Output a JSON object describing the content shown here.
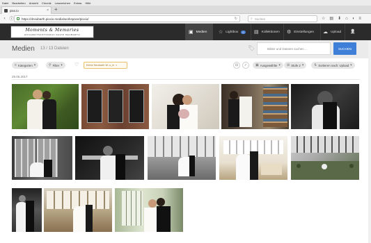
{
  "browser": {
    "menu": [
      "Datei",
      "Bearbeiten",
      "Ansicht",
      "Chronik",
      "Lesezeichen",
      "Extras",
      "Hilfe"
    ],
    "tab_title": "pixx.io",
    "url": "https://dnsubarth.pixxio.media/workspace/pixxio/",
    "search_placeholder": "Suchen",
    "new_tab": "+"
  },
  "logo": {
    "line1": "Moments & Memories",
    "line2": "HOCHZEITSFOTOGRAF DAVID NEUBARTH"
  },
  "nav": [
    {
      "label": "Medien",
      "icon": "▣",
      "active": true
    },
    {
      "label": "Lightbox",
      "icon": "☆",
      "badge": "0"
    },
    {
      "label": "Kollektionen",
      "icon": "▤"
    },
    {
      "label": "Einstellungen",
      "icon": "⚙"
    },
    {
      "label": "Upload",
      "icon": "☁"
    },
    {
      "label": "",
      "icon": "👤"
    }
  ],
  "page": {
    "title": "Medien",
    "count": "13 / 13 Dateien",
    "search_placeholder": "Bilder und Dateien suchen ...",
    "search_button": "SUCHEN"
  },
  "filters": {
    "categories": "Kategorien",
    "filter": "Filter",
    "chip": "Keine Neubarth W..o_in",
    "selection": "Ausgewählte",
    "style": "Stufe 2",
    "sort": "Sortieren nach: Upload"
  },
  "date_group": "29.05.2017",
  "photos": [
    {
      "name": "photo-1",
      "tone": "color-green"
    },
    {
      "name": "photo-2",
      "tone": "color-brick"
    },
    {
      "name": "photo-3",
      "tone": "color-light"
    },
    {
      "name": "photo-4",
      "tone": "color-shelves"
    },
    {
      "name": "photo-5",
      "tone": "bw-dark"
    },
    {
      "name": "photo-6",
      "tone": "bw-windows"
    },
    {
      "name": "photo-7",
      "tone": "bw-hall"
    },
    {
      "name": "photo-8",
      "tone": "bw-room"
    },
    {
      "name": "photo-9",
      "tone": "color-hall-bright"
    },
    {
      "name": "photo-10",
      "tone": "color-courtyard"
    },
    {
      "name": "photo-11",
      "tone": "bw-door"
    },
    {
      "name": "photo-12",
      "tone": "color-gallery"
    },
    {
      "name": "photo-13",
      "tone": "color-window"
    }
  ],
  "colors": {
    "accent": "#3f7fd8",
    "header": "#2b2b2b",
    "chip_border": "#e6c26a"
  }
}
